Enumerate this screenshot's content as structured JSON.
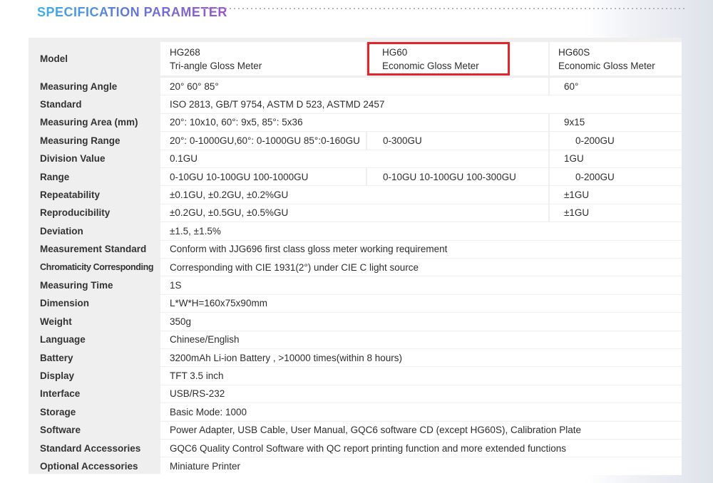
{
  "header": {
    "title": "SPECIFICATION PARAMETER"
  },
  "models": {
    "label": "Model",
    "cols": [
      {
        "code": "HG268",
        "name": "Tri-angle Gloss Meter"
      },
      {
        "code": "HG60",
        "name": "Economic Gloss Meter"
      },
      {
        "code": "HG60S",
        "name": "Economic Gloss Meter"
      }
    ]
  },
  "rows": [
    {
      "label": "Measuring Angle",
      "c1": "20° 60° 85°",
      "c3": "60°"
    },
    {
      "label": "Standard",
      "c1": "ISO 2813, GB/T 9754, ASTM D 523, ASTMD 2457"
    },
    {
      "label": "Measuring Area (mm)",
      "c1": "20°: 10x10,  60°: 9x5,  85°: 5x36",
      "c3": "9x15"
    },
    {
      "label": "Measuring Range",
      "c1": "20°: 0-1000GU,60°: 0-1000GU 85°:0-160GU",
      "c2": "0-300GU",
      "c3": "0-200GU"
    },
    {
      "label": "Division Value",
      "c1": "0.1GU",
      "c3": "1GU"
    },
    {
      "label": "Range",
      "c1": "0-10GU  10-100GU  100-1000GU",
      "c2": "0-10GU 10-100GU 100-300GU",
      "c3": "0-200GU"
    },
    {
      "label": "Repeatability",
      "c1": "±0.1GU, ±0.2GU, ±0.2%GU",
      "c3": "±1GU"
    },
    {
      "label": "Reproducibility",
      "c1": "±0.2GU, ±0.5GU, ±0.5%GU",
      "c3": "±1GU"
    },
    {
      "label": "Deviation",
      "c1": "±1.5, ±1.5%"
    },
    {
      "label": "Measurement Standard",
      "c1": "Conform with JJG696 first class gloss meter working requirement"
    },
    {
      "label": "Chromaticity Corresponding",
      "c1": "Corresponding with CIE 1931(2°)  under CIE C light source"
    },
    {
      "label": "Measuring Time",
      "c1": "1S"
    },
    {
      "label": "Dimension",
      "c1": "L*W*H=160x75x90mm"
    },
    {
      "label": "Weight",
      "c1": "350g"
    },
    {
      "label": "Language",
      "c1": "Chinese/English"
    },
    {
      "label": "Battery",
      "c1": "3200mAh Li-ion Battery , >10000 times(within 8 hours)"
    },
    {
      "label": "Display",
      "c1": "TFT 3.5 inch"
    },
    {
      "label": "Interface",
      "c1": "USB/RS-232"
    },
    {
      "label": "Storage",
      "c1": "Basic Mode: 1000"
    },
    {
      "label": "Software",
      "c1": "Power Adapter, USB Cable, User Manual, GQC6 software CD (except HG60S), Calibration Plate"
    },
    {
      "label": "Standard Accessories",
      "c1": "GQC6 Quality Control Software with QC report printing function and more extended functions"
    },
    {
      "label": "Optional Accessories",
      "c1": "Miniature Printer"
    }
  ],
  "colors": {
    "highlight": "#e0262c",
    "title_start": "#3ab0e8",
    "title_end": "#9a55c8"
  }
}
